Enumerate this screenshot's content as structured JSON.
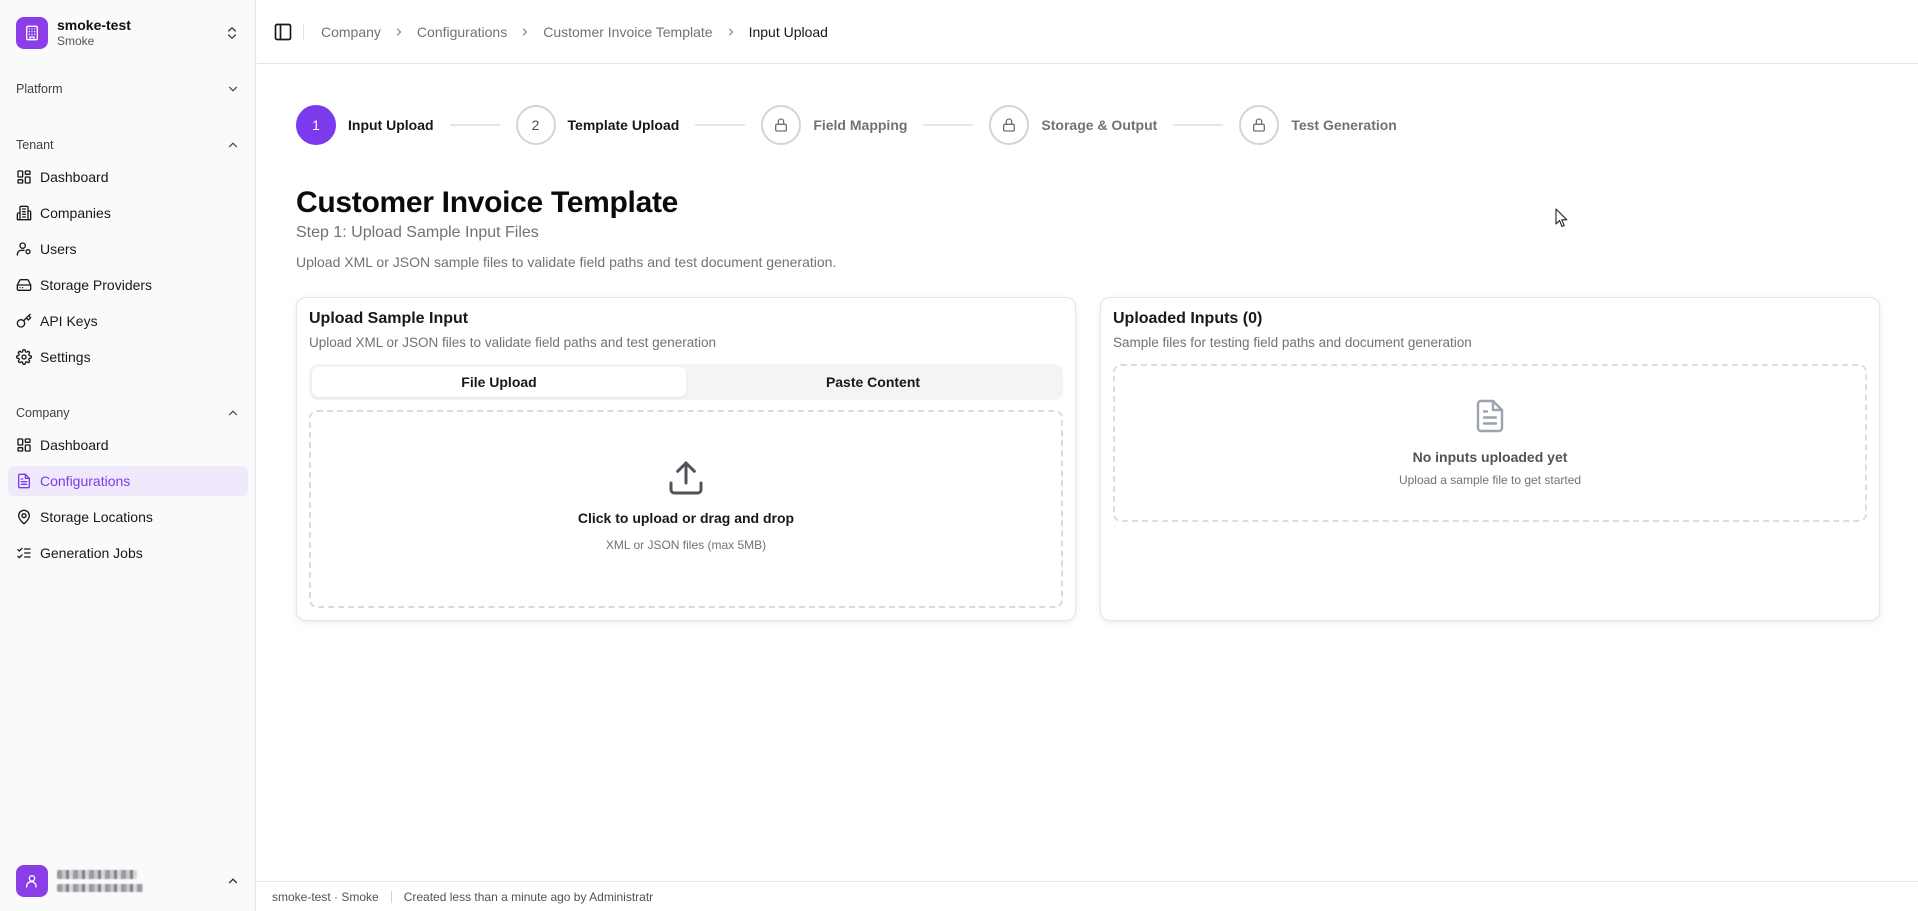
{
  "tenant": {
    "name": "smoke-test",
    "subtitle": "Smoke"
  },
  "sidebar": {
    "platform_label": "Platform",
    "tenant_label": "Tenant",
    "tenant_items": [
      {
        "label": "Dashboard",
        "icon": "dashboard-icon"
      },
      {
        "label": "Companies",
        "icon": "building-icon"
      },
      {
        "label": "Users",
        "icon": "users-icon"
      },
      {
        "label": "Storage Providers",
        "icon": "hard-drive-icon"
      },
      {
        "label": "API Keys",
        "icon": "key-icon"
      },
      {
        "label": "Settings",
        "icon": "gear-icon"
      }
    ],
    "company_label": "Company",
    "company_items": [
      {
        "label": "Dashboard",
        "icon": "dashboard-icon"
      },
      {
        "label": "Configurations",
        "icon": "file-text-icon",
        "active": true
      },
      {
        "label": "Storage Locations",
        "icon": "map-pin-icon"
      },
      {
        "label": "Generation Jobs",
        "icon": "list-checks-icon"
      }
    ]
  },
  "breadcrumb": [
    "Company",
    "Configurations",
    "Customer Invoice Template",
    "Input Upload"
  ],
  "stepper": [
    {
      "marker": "1",
      "label": "Input Upload",
      "state": "active"
    },
    {
      "marker": "2",
      "label": "Template Upload",
      "state": "pending"
    },
    {
      "marker": "lock-icon",
      "label": "Field Mapping",
      "state": "locked"
    },
    {
      "marker": "lock-icon",
      "label": "Storage & Output",
      "state": "locked"
    },
    {
      "marker": "lock-icon",
      "label": "Test Generation",
      "state": "locked"
    }
  ],
  "page": {
    "title": "Customer Invoice Template",
    "subtitle": "Step 1: Upload Sample Input Files",
    "description": "Upload XML or JSON sample files to validate field paths and test document generation."
  },
  "upload_card": {
    "title": "Upload Sample Input",
    "description": "Upload XML or JSON files to validate field paths and test generation",
    "tabs": [
      "File Upload",
      "Paste Content"
    ],
    "active_tab": "File Upload",
    "dropzone_title": "Click to upload or drag and drop",
    "dropzone_sub": "XML or JSON files (max 5MB)"
  },
  "uploaded_card": {
    "title": "Uploaded Inputs (0)",
    "description": "Sample files for testing field paths and document generation",
    "empty_title": "No inputs uploaded yet",
    "empty_sub": "Upload a sample file to get started"
  },
  "footer": {
    "context": "smoke-test · Smoke",
    "created": "Created less than a minute ago by Administratr"
  },
  "colors": {
    "accent": "#7c3aed",
    "active_bg": "#efe9fb"
  }
}
